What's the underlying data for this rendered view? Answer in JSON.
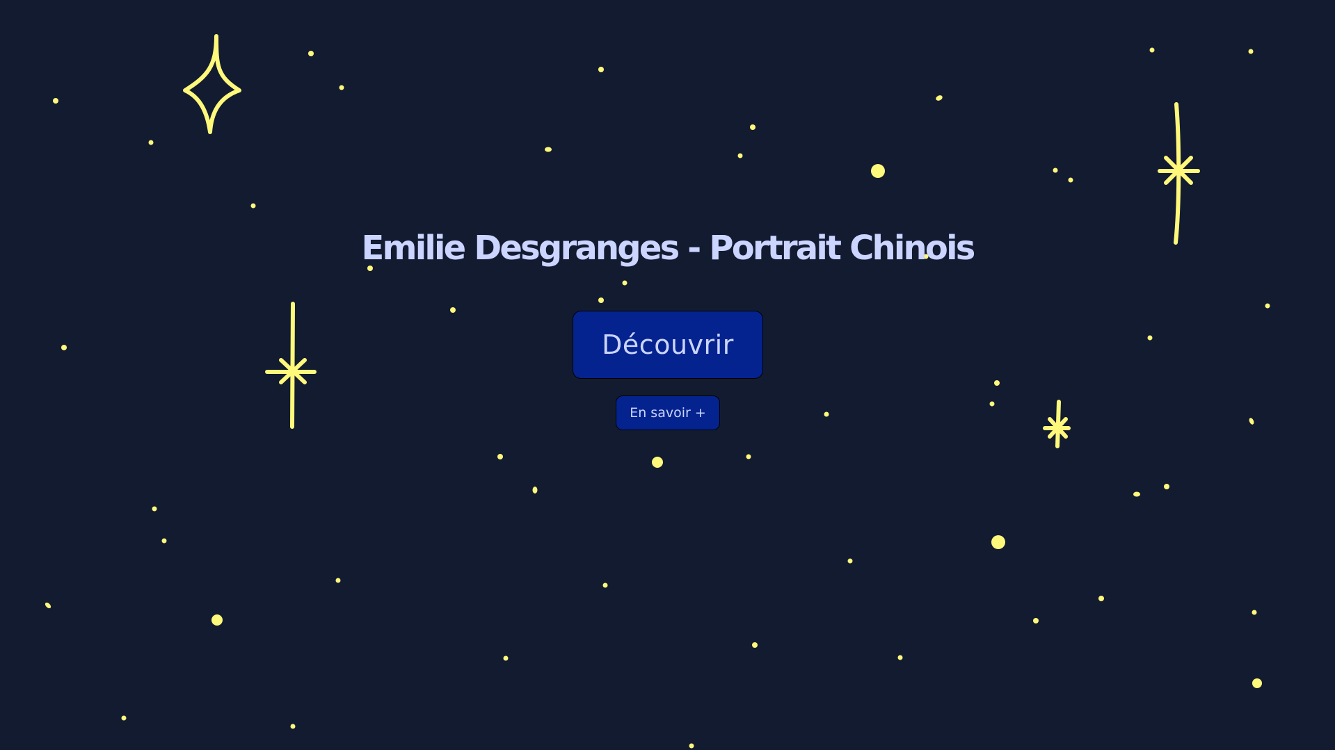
{
  "page": {
    "title": "Emilie Desgranges - Portrait Chinois"
  },
  "actions": {
    "discover_label": "Découvrir",
    "learn_more_label": "En savoir +"
  },
  "colors": {
    "background": "#131b31",
    "star": "#fef87b",
    "text": "#cbd5ff",
    "button": "#05238f"
  },
  "icons": [
    "sparkle-star-icon",
    "twinkle-star-icon",
    "dot-star-icon"
  ]
}
